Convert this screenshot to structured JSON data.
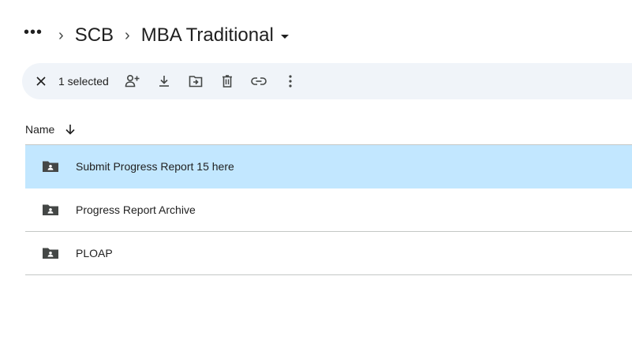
{
  "breadcrumb": {
    "more": "•••",
    "sep": "›",
    "parent": "SCB",
    "current": "MBA Traditional"
  },
  "toolbar": {
    "selected_count": "1 selected",
    "actions": [
      "close-icon",
      "share-icon",
      "download-icon",
      "move-icon",
      "trash-icon",
      "link-icon",
      "more-vert-icon"
    ]
  },
  "list": {
    "column_name": "Name",
    "sort": "descending",
    "rows": [
      {
        "name": "Submit Progress Report 15 here",
        "selected": true
      },
      {
        "name": "Progress Report Archive",
        "selected": false
      },
      {
        "name": "PLOAP",
        "selected": false
      }
    ]
  },
  "colors": {
    "selection": "#c2e7ff",
    "toolbar_bg": "#f0f4f9",
    "folder": "#444746",
    "divider": "#c4c7c5"
  }
}
